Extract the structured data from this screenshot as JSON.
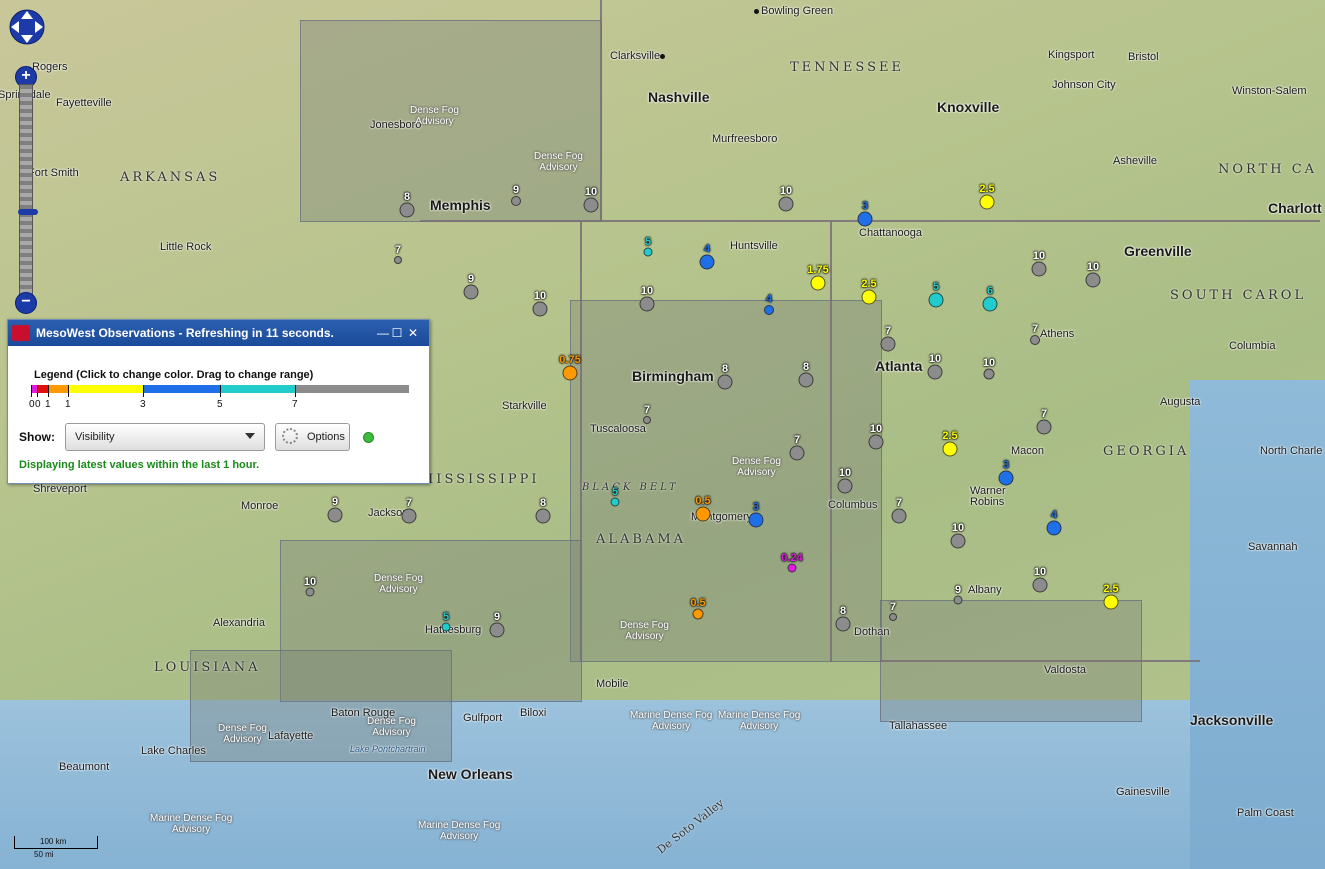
{
  "map": {
    "state_labels": [
      "TENNESSEE",
      "ARKANSAS",
      "MISSISSIPPI",
      "ALABAMA",
      "GEORGIA",
      "LOUISIANA",
      "SOUTH CAROL",
      "NORTH CA"
    ],
    "cities": [
      {
        "name": "Bowling Green",
        "big": false
      },
      {
        "name": "Clarksville",
        "big": false
      },
      {
        "name": "Nashville",
        "big": true
      },
      {
        "name": "Murfreesboro",
        "big": false
      },
      {
        "name": "Knoxville",
        "big": true
      },
      {
        "name": "Kingsport",
        "big": false
      },
      {
        "name": "Bristol",
        "big": false
      },
      {
        "name": "Johnson City",
        "big": false
      },
      {
        "name": "Winston-Salem",
        "big": false
      },
      {
        "name": "Asheville",
        "big": false
      },
      {
        "name": "Charlott",
        "big": true
      },
      {
        "name": "Greenville",
        "big": true
      },
      {
        "name": "Columbia",
        "big": false
      },
      {
        "name": "Augusta",
        "big": false
      },
      {
        "name": "North Charle",
        "big": false
      },
      {
        "name": "Savannah",
        "big": false
      },
      {
        "name": "Jacksonville",
        "big": true
      },
      {
        "name": "Gainesville",
        "big": false
      },
      {
        "name": "Palm Coast",
        "big": false
      },
      {
        "name": "Valdosta",
        "big": false
      },
      {
        "name": "Tallahassee",
        "big": false
      },
      {
        "name": "Albany",
        "big": false
      },
      {
        "name": "Dothan",
        "big": false
      },
      {
        "name": "Macon",
        "big": false
      },
      {
        "name": "Warner Robins",
        "big": false
      },
      {
        "name": "Columbus",
        "big": false
      },
      {
        "name": "Athens",
        "big": false
      },
      {
        "name": "Atlanta",
        "big": true
      },
      {
        "name": "Chattanooga",
        "big": false
      },
      {
        "name": "Huntsville",
        "big": false
      },
      {
        "name": "Birmingham",
        "big": true
      },
      {
        "name": "Tuscaloosa",
        "big": false
      },
      {
        "name": "Montgomery",
        "big": false
      },
      {
        "name": "Mobile",
        "big": false
      },
      {
        "name": "Biloxi",
        "big": false
      },
      {
        "name": "Gulfport",
        "big": false
      },
      {
        "name": "New Orleans",
        "big": true
      },
      {
        "name": "Baton Rouge",
        "big": false
      },
      {
        "name": "Lafayette",
        "big": false
      },
      {
        "name": "Lake Charles",
        "big": false
      },
      {
        "name": "Beaumont",
        "big": false
      },
      {
        "name": "Alexandria",
        "big": false
      },
      {
        "name": "Hattiesburg",
        "big": false
      },
      {
        "name": "Jackson",
        "big": false
      },
      {
        "name": "Monroe",
        "big": false
      },
      {
        "name": "Shreveport",
        "big": false
      },
      {
        "name": "Starkville",
        "big": false
      },
      {
        "name": "Memphis",
        "big": true
      },
      {
        "name": "Jonesboro",
        "big": false
      },
      {
        "name": "Little Rock",
        "big": false
      },
      {
        "name": "Fort Smith",
        "big": false
      },
      {
        "name": "Fayetteville",
        "big": false
      },
      {
        "name": "Rogers",
        "big": false
      },
      {
        "name": "Springdale",
        "big": false
      }
    ],
    "advisories": [
      {
        "line1": "Dense Fog",
        "line2": "Advisory"
      },
      {
        "line1": "Dense Fog",
        "line2": "Advisory"
      },
      {
        "line1": "Dense Fog",
        "line2": "Advisory"
      },
      {
        "line1": "Dense Fog",
        "line2": "Advisory"
      },
      {
        "line1": "Dense Fog",
        "line2": "Advisory"
      },
      {
        "line1": "Dense Fog",
        "line2": "Advisory"
      },
      {
        "line1": "Dense Fog",
        "line2": "Advisory"
      },
      {
        "line1": "Marine Dense Fog",
        "line2": "Advisory"
      },
      {
        "line1": "Marine Dense Fog",
        "line2": "Advisory"
      },
      {
        "line1": "Marine Dense Fog",
        "line2": "Advisory"
      },
      {
        "line1": "Marine Dense Fog",
        "line2": "Advisory"
      }
    ],
    "features": {
      "black_belt": "BLACK BELT",
      "de_soto": "De Soto Valley",
      "lake": "Lake Pontchartrain"
    },
    "stations": [
      {
        "value": "8"
      },
      {
        "value": "9"
      },
      {
        "value": "10"
      },
      {
        "value": "10"
      },
      {
        "value": "3"
      },
      {
        "value": "2.5"
      },
      {
        "value": "7"
      },
      {
        "value": "5"
      },
      {
        "value": "4"
      },
      {
        "value": "1.75"
      },
      {
        "value": "2.5"
      },
      {
        "value": "5"
      },
      {
        "value": "6"
      },
      {
        "value": "10"
      },
      {
        "value": "10"
      },
      {
        "value": "9"
      },
      {
        "value": "10"
      },
      {
        "value": "10"
      },
      {
        "value": "4"
      },
      {
        "value": "7"
      },
      {
        "value": "7"
      },
      {
        "value": "10"
      },
      {
        "value": "10"
      },
      {
        "value": "0.75"
      },
      {
        "value": "8"
      },
      {
        "value": "8"
      },
      {
        "value": "7"
      },
      {
        "value": "7"
      },
      {
        "value": "10"
      },
      {
        "value": "2.5"
      },
      {
        "value": "7"
      },
      {
        "value": "3"
      },
      {
        "value": "9"
      },
      {
        "value": "7"
      },
      {
        "value": "8"
      },
      {
        "value": "5"
      },
      {
        "value": "0.5"
      },
      {
        "value": "3"
      },
      {
        "value": "10"
      },
      {
        "value": "7"
      },
      {
        "value": "10"
      },
      {
        "value": "4"
      },
      {
        "value": "0.24"
      },
      {
        "value": "10"
      },
      {
        "value": "5"
      },
      {
        "value": "9"
      },
      {
        "value": "0.5"
      },
      {
        "value": "8"
      },
      {
        "value": "7"
      },
      {
        "value": "9"
      },
      {
        "value": "10"
      },
      {
        "value": "2.5"
      }
    ],
    "scale": {
      "km": "100 km",
      "mi": "50 mi"
    }
  },
  "panel": {
    "title": "MesoWest Observations - Refreshing in 11 seconds.",
    "legend_title": "Legend (Click to change color. Drag to change range)",
    "ticks": [
      "0",
      "0",
      "1",
      "1",
      "3",
      "5",
      "7"
    ],
    "show_label": "Show:",
    "show_value": "Visibility",
    "options_label": "Options",
    "status": "Displaying latest values within the last 1 hour.",
    "controls": {
      "minimize": "—",
      "maximize": "☐",
      "close": "✕"
    }
  },
  "colors": {
    "magenta": "#e01ce0",
    "red": "#e01010",
    "orange": "#ff9900",
    "yellow": "#ffff00",
    "blue": "#1f6fe8",
    "cyan": "#22cccc",
    "gray": "#8c8c8c",
    "accent": "#1a4b9a",
    "status": "#1a8a1a"
  }
}
